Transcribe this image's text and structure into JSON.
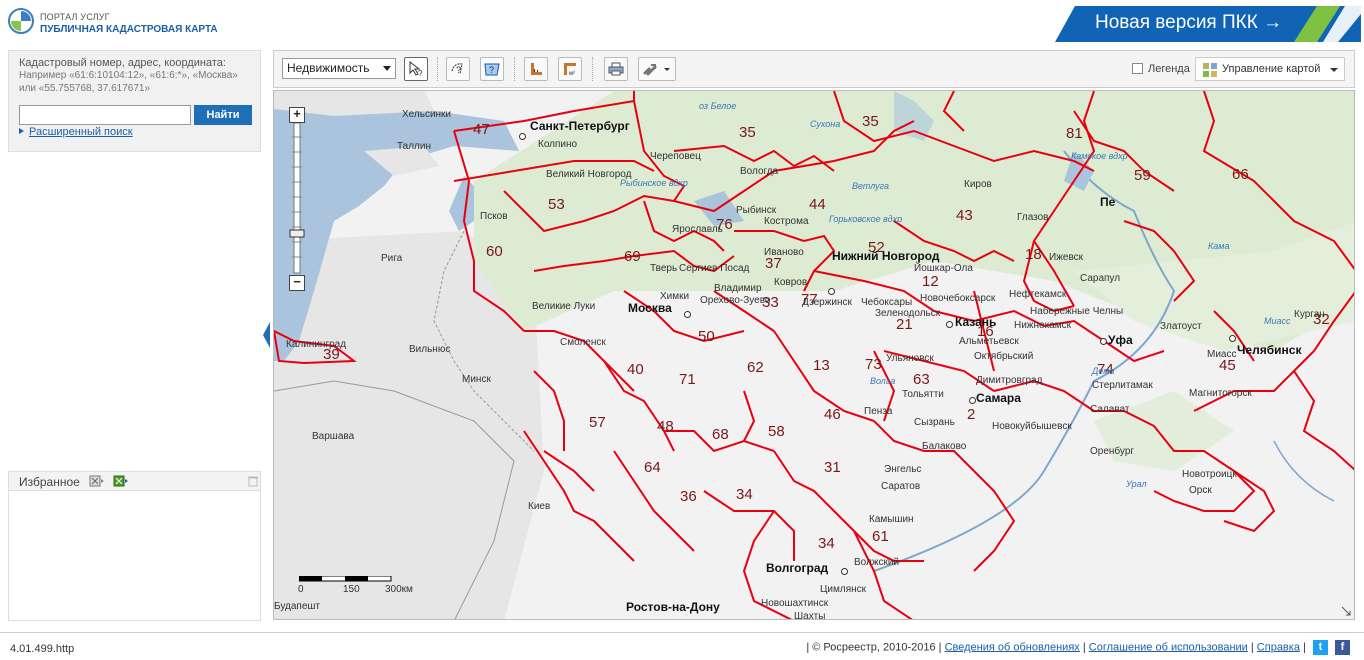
{
  "header": {
    "portal_top": "ПОРТАЛ УСЛУГ",
    "portal_main": "ПУБЛИЧНАЯ КАДАСТРОВАЯ КАРТА",
    "new_version": "Новая версия ПКК →",
    "new_version_color": "#1063b5"
  },
  "search": {
    "hint": "Кадастровый номер, адрес, координата:",
    "example": "Например «61:6:10104:12», «61:6:*», «Москва» или «55.755768, 37.617671»",
    "value": "",
    "button": "Найти",
    "advanced": "Расширенный поиск"
  },
  "favorites": {
    "title": "Избранное"
  },
  "toolbar": {
    "layer_select": "Недвижимость",
    "legend_label": "Легенда",
    "legend_checked": false,
    "map_management": "Управление картой"
  },
  "map": {
    "border_color": "#e8000f",
    "land_color": "#f2f2f2",
    "forest_color": "#dcebd2",
    "sea_color": "#a9c4dc",
    "foreign_color": "#e6e6e6",
    "scale": {
      "l0": "0",
      "l1": "150",
      "l2": "300км"
    },
    "regions": [
      "47",
      "35",
      "35",
      "81",
      "59",
      "66",
      "76",
      "44",
      "43",
      "53",
      "60",
      "69",
      "52",
      "12",
      "18",
      "37",
      "33",
      "77",
      "16",
      "21",
      "50",
      "39",
      "40",
      "71",
      "62",
      "13",
      "73",
      "63",
      "2",
      "74",
      "45",
      "32",
      "57",
      "48",
      "68",
      "58",
      "46",
      "64",
      "31",
      "36",
      "34",
      "34",
      "61"
    ],
    "cities": [
      "Санкт-Петербург",
      "Москва",
      "Нижний Новгород",
      "Казань",
      "Самара",
      "Уфа",
      "Челябинск",
      "Волгоград",
      "Ростов-на-Дону",
      "Пе"
    ],
    "towns": [
      "Хельсинки",
      "Таллин",
      "Рига",
      "Вильнюс",
      "Минск",
      "Варшава",
      "Киев",
      "Калининград",
      "Псков",
      "Великий Новгород",
      "Колпино",
      "Череповец",
      "Вологда",
      "Рыбинск",
      "Кострома",
      "Ярославль",
      "Иваново",
      "Тверь",
      "Сергиев Посад",
      "Химки",
      "Орехово-Зуево",
      "Владимир",
      "Ковров",
      "Дзержинск",
      "Чебоксары",
      "Зеленодольск",
      "Новочебоксарск",
      "Йошкар-Ола",
      "Киров",
      "Глазов",
      "Ижевск",
      "Сарапул",
      "Нефтекамск",
      "Набережные Челны",
      "Нижнекамск",
      "Альметьевск",
      "Октябрьский",
      "Ульяновск",
      "Димитровград",
      "Тольятти",
      "Сызрань",
      "Новокуйбышевск",
      "Балаково",
      "Пенза",
      "Энгельс",
      "Саратов",
      "Оренбург",
      "Орск",
      "Новотроицк",
      "Стерлитамак",
      "Салават",
      "Магнитогорск",
      "Миасс",
      "Златоуст",
      "Курган",
      "Смоленск",
      "Великие Луки",
      "Камышин",
      "Волжский",
      "Новошахтинск",
      "Шахты",
      "Будапешт",
      "Цимлянск"
    ],
    "waters": [
      "оз Белое",
      "Сухона",
      "Рыбинское вдхр",
      "Горьковское вдхр",
      "Ветлуга",
      "Камское вдхр",
      "Волга",
      "Кама",
      "Дема",
      "Урал",
      "Миасс"
    ]
  },
  "footer": {
    "version": "4.01.499.http",
    "copyright": "© Росреестр, 2010-2016",
    "link_updates": "Сведения об обновлениях",
    "link_agreement": "Соглашение об использовании",
    "link_help": "Справка",
    "twitter_color": "#1da1f2",
    "facebook_color": "#3b5998"
  }
}
